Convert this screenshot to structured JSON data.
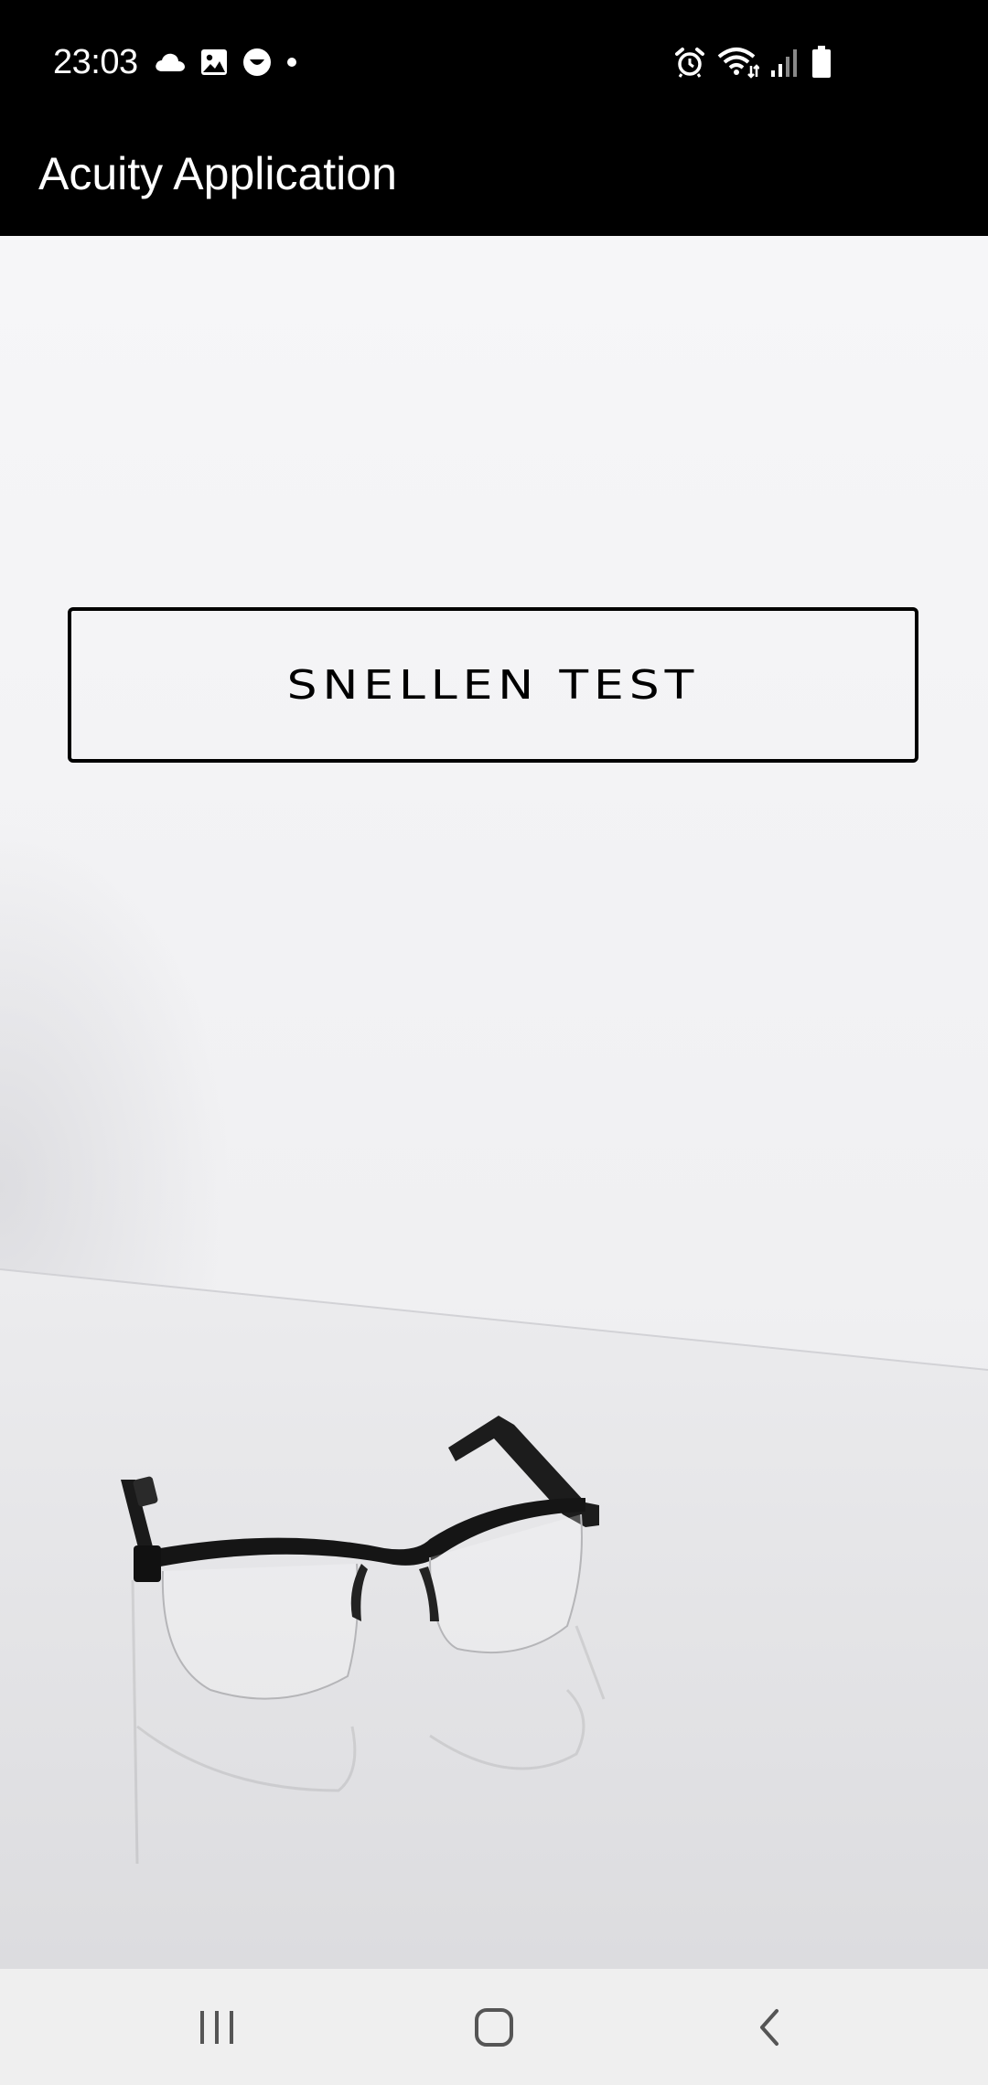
{
  "status_bar": {
    "time": "23:03",
    "left_icons": [
      "cloud-icon",
      "image-icon",
      "smiley-icon",
      "dot-icon"
    ],
    "right_icons": [
      "alarm-icon",
      "wifi-icon",
      "signal-icon",
      "battery-icon"
    ]
  },
  "app_bar": {
    "title": "Acuity Application"
  },
  "main": {
    "snellen_button_label": "SNELLEN TEST",
    "background_image": "eyeglasses-on-white-surface"
  },
  "nav_bar": {
    "buttons": [
      "recent-apps",
      "home",
      "back"
    ]
  },
  "colors": {
    "status_bar_bg": "#000000",
    "app_bar_bg": "#000000",
    "content_bg": "#f2f2f4",
    "nav_bar_bg": "#efefef",
    "button_border": "#000000"
  }
}
